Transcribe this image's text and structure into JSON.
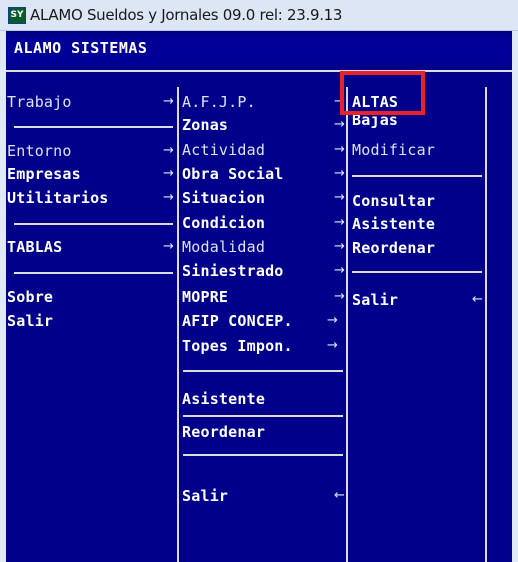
{
  "window": {
    "icon_text": "SY",
    "title": "ALAMO Sueldos y Jornales 09.0 rel: 23.9.13"
  },
  "app": {
    "header": "ALAMO SISTEMAS"
  },
  "main_menu": {
    "items": [
      "Trabajo",
      "Entorno",
      "Empresas",
      "Utilitarios",
      "TABLAS",
      "Sobre",
      "Salir"
    ]
  },
  "tablas_menu": {
    "items": [
      "A.F.J.P.",
      "Zonas",
      "Actividad",
      "Obra Social",
      "Situacion",
      "Condicion",
      "Modalidad",
      "Siniestrado",
      "MOPRE",
      "AFIP CONCEP.",
      "Topes Impon.",
      "Asistente",
      "Reordenar",
      "Salir"
    ]
  },
  "afjp_menu": {
    "items": [
      "ALTAS",
      "Bajas",
      "Modificar",
      "Consultar",
      "Asistente",
      "Reordenar",
      "Salir"
    ]
  },
  "icons": {
    "submenu": "→",
    "back": "←"
  },
  "colors": {
    "screen_bg": "#00008b",
    "text": "#dfe3f5",
    "lines": "#dcdcdc",
    "selection": "#e8222a"
  }
}
